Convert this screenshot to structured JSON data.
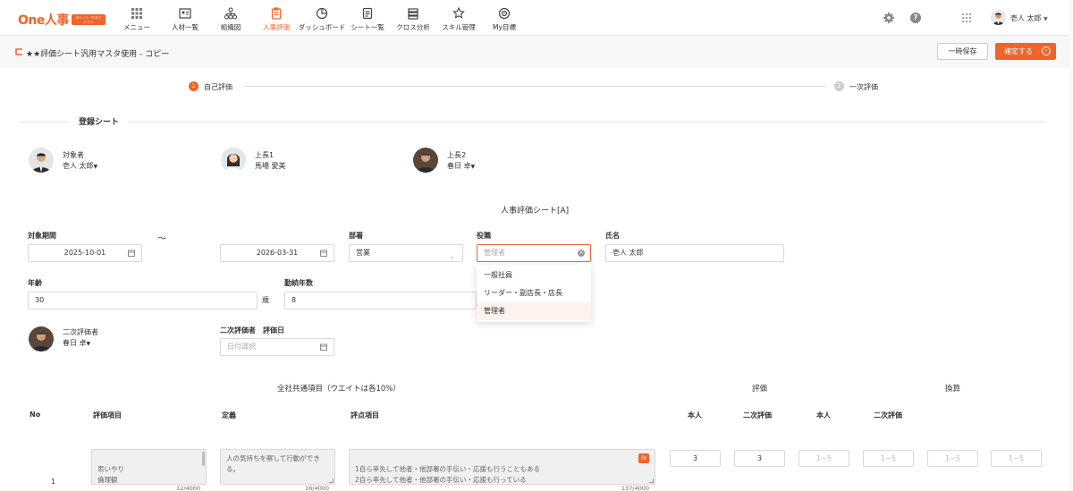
{
  "app": {
    "logo": "One人事",
    "logo_badge": "タレント マネジメント"
  },
  "nav": [
    {
      "label": "メニュー",
      "icon": "grid-icon"
    },
    {
      "label": "人材一覧",
      "icon": "id-card-icon"
    },
    {
      "label": "組織図",
      "icon": "org-chart-icon"
    },
    {
      "label": "人事評価",
      "icon": "clipboard-icon",
      "active": true
    },
    {
      "label": "ダッシュボード",
      "icon": "pie-chart-icon"
    },
    {
      "label": "シート一覧",
      "icon": "document-icon"
    },
    {
      "label": "クロス分析",
      "icon": "stack-icon"
    },
    {
      "label": "スキル管理",
      "icon": "star-badge-icon"
    },
    {
      "label": "My目標",
      "icon": "target-icon"
    }
  ],
  "user": {
    "name": "壱人 太郎"
  },
  "header": {
    "title": "★★評価シート汎用マスタ使用 - コピー",
    "save_label": "一時保存",
    "confirm_label": "確定する"
  },
  "stepper": {
    "step1": {
      "num": "1",
      "label": "自己評価"
    },
    "step2": {
      "num": "2",
      "label": "一次評価"
    }
  },
  "registration": {
    "section_title": "登録シート",
    "target": {
      "role": "対象者",
      "name": "壱人 太郎"
    },
    "boss1": {
      "role": "上長1",
      "name": "馬場 愛美"
    },
    "boss2": {
      "role": "上長2",
      "name": "春日 卓"
    }
  },
  "sheet_title": "人事評価シート[A]",
  "form": {
    "period_label": "対象期間",
    "period_start": "2025-10-01",
    "period_sep": "～",
    "period_end": "2026-03-31",
    "dept_label": "部署",
    "dept_value": "営業",
    "position_label": "役職",
    "position_placeholder": "管理者",
    "name_label": "氏名",
    "name_value": "壱人 太郎",
    "age_label": "年齢",
    "age_value": "30",
    "age_unit": "歳",
    "tenure_label": "勤続年数",
    "tenure_value": "8",
    "second_evaluator_role": "二次評価者",
    "second_evaluator_name": "春日 卓",
    "second_eval_date_label": "二次評価者　評価日",
    "date_placeholder": "日付選択"
  },
  "position_options": [
    "一般社員",
    "リーダー・副店長・店長",
    "管理者"
  ],
  "table": {
    "section_title": "全社共通項目（ウエイトは各10%）",
    "eval_group": "評価",
    "convert_group": "換算",
    "headers": {
      "no": "No",
      "item": "評価項目",
      "definition": "定義",
      "points": "評点項目",
      "self": "本人",
      "second": "二次評価",
      "self2": "本人",
      "second2": "二次評価"
    },
    "rows": [
      {
        "no": "1",
        "item": "思いやり\n倫理観",
        "item_count": "12/4000",
        "definition": "人の気持ちを察して行動ができる。",
        "definition_count": "16/4000",
        "points": "1自ら率先して他者・他部署の手伝い・応援も行うこともある\n2自ら率先して他者・他部署の手伝い・応援も行っている",
        "points_count": "137/4000",
        "fx": "fx",
        "self_score": "3",
        "second_score": "3",
        "range_placeholder": "1~5"
      }
    ]
  },
  "colors": {
    "accent": "#f0642a"
  }
}
